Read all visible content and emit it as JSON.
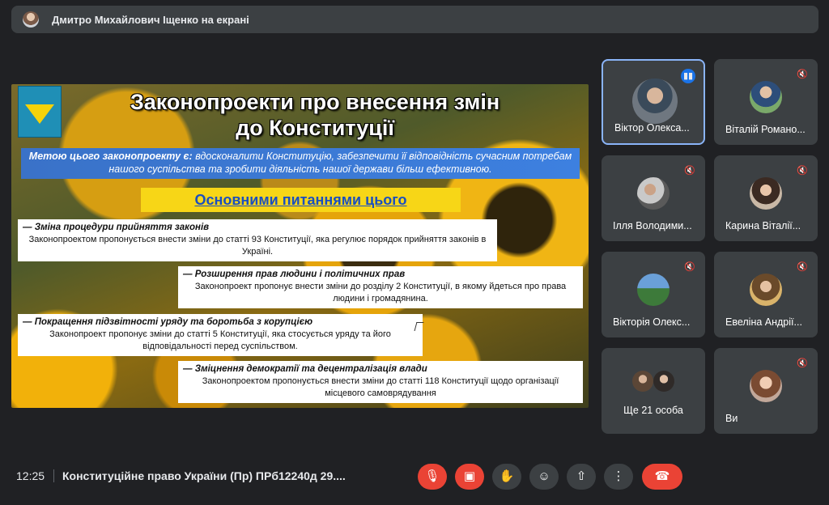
{
  "presenter_banner": {
    "text": "Дмитро Михайлович Іщенко на екрані"
  },
  "slide": {
    "title_line1": "Законопроекти про внесення змін",
    "title_line2": "до Конституції",
    "goal_label": "Метою цього законопроекту є:",
    "goal_text": "вдосконалити Конституцію, забезпечити її відповідність сучасним потребам нашого суспільства та зробити діяльність нашої держави більш ефективною.",
    "main_questions": "Основними питаннями цього законопроекту є:",
    "items": [
      {
        "heading": "— Зміна процедури прийняття законів",
        "body": "Законопроектом пропонується внести зміни до статті 93 Конституції, яка регулює порядок прийняття законів в Україні."
      },
      {
        "heading": "— Розширення прав людини і політичних прав",
        "body": "Законопроект пропонує внести зміни до розділу 2 Конституції, в якому йдеться про права людини і громадянина."
      },
      {
        "heading": "— Покращення підзвітності уряду та боротьба з корупцією",
        "body": "Законопроект пропонує зміни до статті 5 Конституції, яка стосується уряду та його відповідальності перед суспільством."
      },
      {
        "heading": "— Зміцнення демократії та децентралізація влади",
        "body": "Законопроектом пропонується внести зміни до статті 118 Конституції щодо організації місцевого самоврядування"
      }
    ]
  },
  "participants": [
    {
      "name": "Віктор Олекса...",
      "speaking": true
    },
    {
      "name": "Віталій Романо...",
      "speaking": false
    },
    {
      "name": "Ілля Володими...",
      "speaking": false
    },
    {
      "name": "Карина Віталії...",
      "speaking": false
    },
    {
      "name": "Вікторія Олекс...",
      "speaking": false
    },
    {
      "name": "Евеліна Андрії...",
      "speaking": false
    },
    {
      "name": "Ще 21 особа",
      "speaking": false
    },
    {
      "name": "Ви",
      "speaking": false
    }
  ],
  "bottom_bar": {
    "time": "12:25",
    "meeting_title": "Конституційне право України (Пр) ПРб12240д 29...."
  },
  "colors": {
    "background": "#202124",
    "tile": "#3c4043",
    "danger": "#ea4335",
    "accent": "#8ab4f8",
    "speaking": "#1a73e8"
  }
}
